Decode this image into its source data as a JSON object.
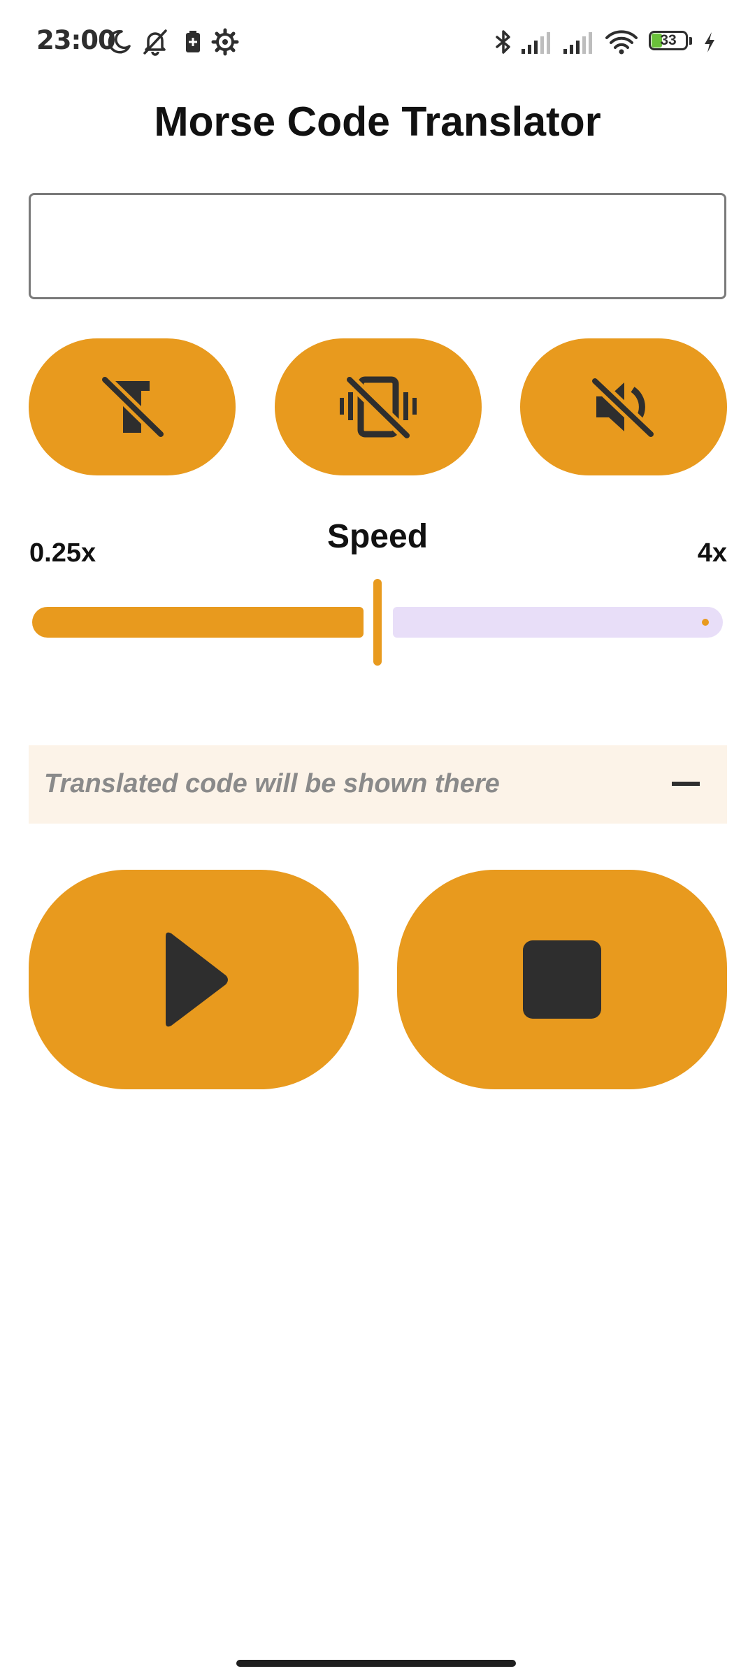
{
  "status_bar": {
    "time": "23:00",
    "battery_level": "33",
    "icons": [
      "moon-icon",
      "bell-off-icon",
      "battery-saver-icon",
      "settings-gear-icon",
      "bluetooth-icon",
      "signal-icon",
      "signal-icon",
      "wifi-icon",
      "battery-icon",
      "charging-icon"
    ]
  },
  "app": {
    "title": "Morse Code Translator"
  },
  "input": {
    "value": "",
    "placeholder": ""
  },
  "toggles": [
    {
      "name": "flashlight-off",
      "icon": "flashlight-off-icon"
    },
    {
      "name": "vibration-off",
      "icon": "vibration-off-icon"
    },
    {
      "name": "sound-off",
      "icon": "volume-off-icon"
    }
  ],
  "speed": {
    "label": "Speed",
    "min_label": "0.25x",
    "max_label": "4x",
    "value_fraction": 0.5
  },
  "output": {
    "placeholder": "Translated code will be shown there",
    "trailing_icon": "dash-icon"
  },
  "controls": {
    "play_icon": "play-icon",
    "stop_icon": "stop-icon"
  },
  "colors": {
    "accent": "#e89a1e",
    "icon": "#2e2e2e",
    "slider_track_inactive": "#e8def8",
    "output_background": "#fcf3e8",
    "placeholder_text": "#8a8a8a"
  }
}
